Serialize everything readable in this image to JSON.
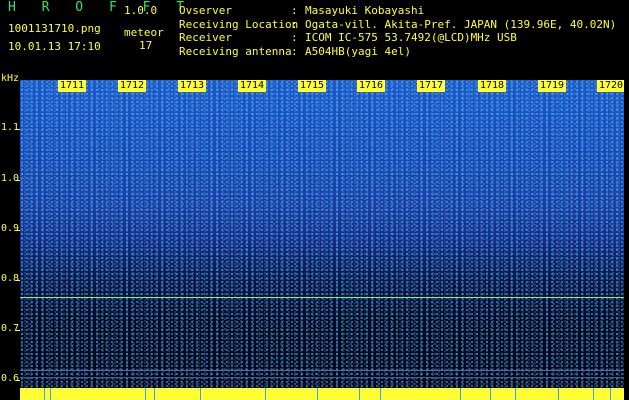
{
  "app": {
    "title": "H R O F F T",
    "version": "1.0.0"
  },
  "file": {
    "name": "1001131710.png",
    "datetime": "10.01.13 17:10"
  },
  "meteor": {
    "label": "meteor",
    "count": "17"
  },
  "info": [
    {
      "key": "Ovserver",
      "sep": ":",
      "value": "Masayuki Kobayashi"
    },
    {
      "key": "Receiving Location",
      "sep": ":",
      "value": "Ogata-vill. Akita-Pref. JAPAN (139.96E, 40.02N)"
    },
    {
      "key": "Receiver",
      "sep": ":",
      "value": "ICOM IC-575 53.7492(@LCD)MHz USB"
    },
    {
      "key": "Receiving antenna",
      "sep": ":",
      "value": "A504HB(yagi 4el)"
    }
  ],
  "axis": {
    "unit": "kHz",
    "y_labels": [
      "1.1",
      "1.0",
      "0.9",
      "0.8",
      "0.7",
      "0.6"
    ],
    "time_markers": [
      "1711",
      "1712",
      "1713",
      "1714",
      "1715",
      "1716",
      "1717",
      "1718",
      "1719",
      "1720"
    ]
  },
  "colors": {
    "text": "#ffff33",
    "title": "#35e06a",
    "spectrum_top": "#1f58c8",
    "spectrum_bottom": "#060820",
    "signal_line": "#7cf08a"
  }
}
